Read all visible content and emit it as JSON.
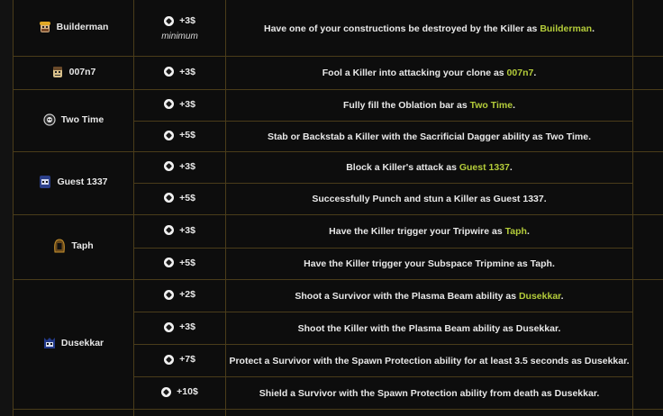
{
  "colors": {
    "accent": "#b4cc3a",
    "border": "#4a3c1a",
    "background": "#0d0d0d"
  },
  "rows": [
    {
      "survivor": "Builderman",
      "icon": "builderman-avatar-icon",
      "achievements": [
        {
          "reward": "+3$",
          "note": "minimum",
          "desc_pre": "Have one of your constructions be destroyed by the Killer as ",
          "desc_hl": "Builderman",
          "desc_post": "."
        }
      ]
    },
    {
      "survivor": "007n7",
      "icon": "007n7-avatar-icon",
      "achievements": [
        {
          "reward": "+3$",
          "desc_pre": "Fool a Killer into attacking your clone as ",
          "desc_hl": "007n7",
          "desc_post": "."
        }
      ]
    },
    {
      "survivor": "Two Time",
      "icon": "two-time-avatar-icon",
      "achievements": [
        {
          "reward": "+3$",
          "desc_pre": "Fully fill the Oblation bar as ",
          "desc_hl": "Two Time",
          "desc_post": "."
        },
        {
          "reward": "+5$",
          "desc_pre": "Stab or Backstab a Killer with the Sacrificial Dagger ability as Two Time.",
          "desc_hl": "",
          "desc_post": ""
        }
      ]
    },
    {
      "survivor": "Guest 1337",
      "icon": "guest-1337-avatar-icon",
      "achievements": [
        {
          "reward": "+3$",
          "desc_pre": "Block a Killer's attack as ",
          "desc_hl": "Guest 1337",
          "desc_post": "."
        },
        {
          "reward": "+5$",
          "desc_pre": "Successfully Punch and stun a Killer as Guest 1337.",
          "desc_hl": "",
          "desc_post": ""
        }
      ]
    },
    {
      "survivor": "Taph",
      "icon": "taph-avatar-icon",
      "achievements": [
        {
          "reward": "+3$",
          "desc_pre": "Have the Killer trigger your Tripwire as ",
          "desc_hl": "Taph",
          "desc_post": "."
        },
        {
          "reward": "+5$",
          "desc_pre": "Have the Killer trigger your Subspace Tripmine as Taph.",
          "desc_hl": "",
          "desc_post": ""
        }
      ]
    },
    {
      "survivor": "Dusekkar",
      "icon": "dusekkar-avatar-icon",
      "achievements": [
        {
          "reward": "+2$",
          "desc_pre": "Shoot a Survivor with the Plasma Beam ability as ",
          "desc_hl": "Dusekkar",
          "desc_post": "."
        },
        {
          "reward": "+3$",
          "desc_pre": "Shoot the Killer with the Plasma Beam ability as Dusekkar.",
          "desc_hl": "",
          "desc_post": ""
        },
        {
          "reward": "+7$",
          "desc_pre": "Protect a Survivor with the Spawn Protection ability for at least 3.5 seconds as Dusekkar.",
          "desc_hl": "",
          "desc_post": ""
        },
        {
          "reward": "+10$",
          "desc_pre": "Shield a Survivor with the Spawn Protection ability from death as Dusekkar.",
          "desc_hl": "",
          "desc_post": ""
        }
      ]
    }
  ]
}
